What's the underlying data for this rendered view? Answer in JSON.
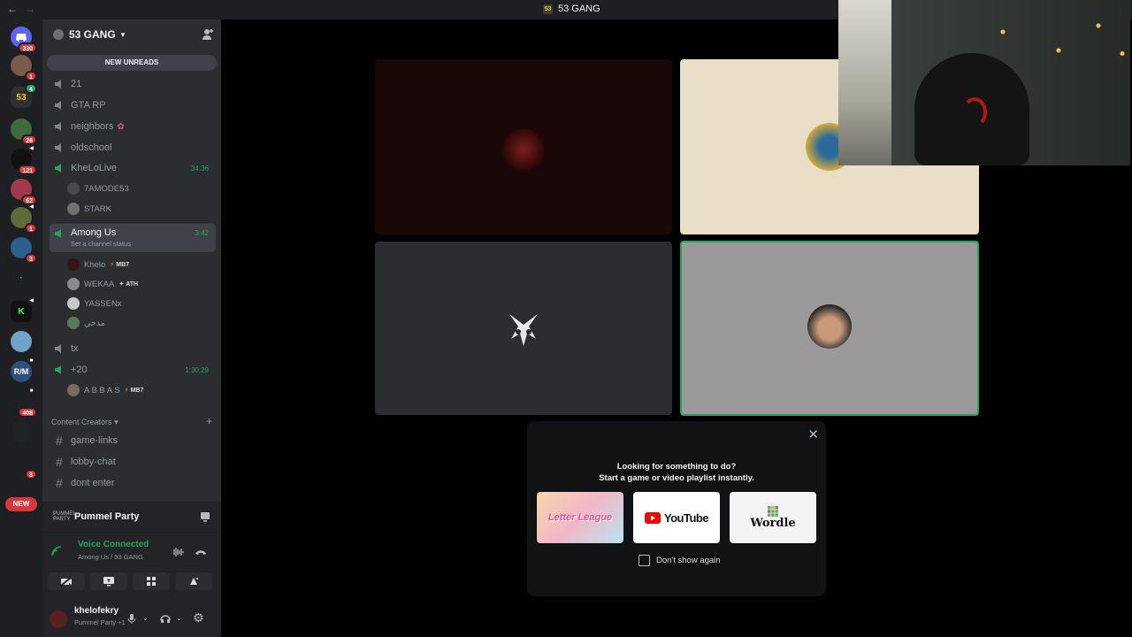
{
  "window": {
    "title": "53 GANG",
    "back": "←",
    "forward": "→"
  },
  "rail": {
    "badges": [
      "330",
      "1",
      "4",
      "26",
      "121",
      "62",
      "1",
      "3",
      "408",
      "3"
    ],
    "new_label": "NEW"
  },
  "server": {
    "name": "53 GANG",
    "new_unreads": "NEW UNREADS"
  },
  "channels": {
    "c21": "21",
    "gta": "GTA RP",
    "neighbors": "neighbors",
    "oldschool": "oldschool",
    "khelolive": {
      "name": "KheLoLive",
      "time": "34:36",
      "users": [
        "7AMODE53",
        "STARK"
      ]
    },
    "amongus": {
      "name": "Among Us",
      "time": "3:42",
      "status": "Set a channel status",
      "users": [
        {
          "name": "Khelo",
          "tag": "MB7"
        },
        {
          "name": "WEKAA",
          "tag": "ATH"
        },
        {
          "name": "YASSENx",
          "tag": ""
        },
        {
          "name": "مدحي",
          "tag": ""
        }
      ]
    },
    "tx": "tx",
    "plus20": {
      "name": "+20",
      "time": "1:30:29",
      "user": {
        "name": "A B B A S",
        "tag": "MB7"
      }
    },
    "category": "Content Creators",
    "text": [
      "game-links",
      "lobby-chat",
      "dont enter"
    ]
  },
  "activity": {
    "logo": "PUMMEL PARTY",
    "name": "Pummel Party"
  },
  "voice": {
    "title": "Voice Connected",
    "subtitle": "Among Us / 53 GANG"
  },
  "user": {
    "name": "khelofekry",
    "status": "Pummel Party +1"
  },
  "popup": {
    "line1": "Looking for something to do?",
    "line2": "Start a game or video playlist instantly.",
    "cards": [
      "Letter League",
      "YouTube",
      "Wordle"
    ],
    "dont_show": "Don't show again"
  },
  "colors": {
    "accent_green": "#23a55a",
    "danger_red": "#da373c",
    "sidebar": "#2b2d31",
    "rail": "#1e1f22"
  }
}
